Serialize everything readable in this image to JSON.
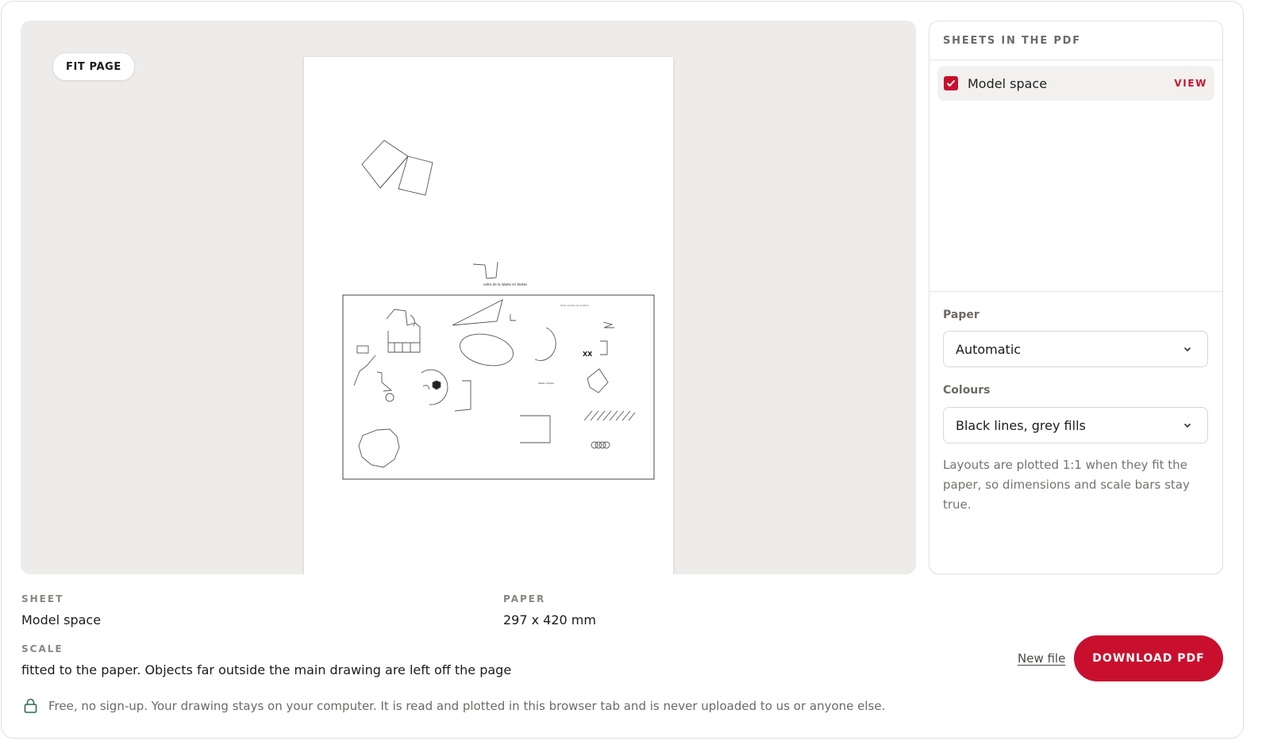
{
  "preview": {
    "fit_label": "FIT PAGE",
    "drawing_texts": {
      "caption_above": "vetro de la labelo en blokes",
      "small_note": "Texto primer en el título",
      "center_note": "labelo simple",
      "xx_mark": "XX"
    }
  },
  "sidebar": {
    "heading": "SHEETS IN THE PDF",
    "sheets": [
      {
        "name": "Model space",
        "checked": true,
        "action": "VIEW"
      }
    ],
    "paper": {
      "label": "Paper",
      "value": "Automatic"
    },
    "colours": {
      "label": "Colours",
      "value": "Black lines, grey fills"
    },
    "hint": "Layouts are plotted 1:1 when they fit the paper, so dimensions and scale bars stay true."
  },
  "info": {
    "sheet_label": "SHEET",
    "sheet_value": "Model space",
    "paper_label": "PAPER",
    "paper_value": "297 x 420 mm",
    "scale_label": "SCALE",
    "scale_value": "fitted to the paper. Objects far outside the main drawing are left off the page"
  },
  "actions": {
    "new_file": "New file",
    "download": "DOWNLOAD PDF"
  },
  "privacy": "Free, no sign-up. Your drawing stays on your computer. It is read and plotted in this browser tab and is never uploaded to us or anyone else.",
  "colors": {
    "accent": "#c8102e",
    "preview_bg": "#edecea"
  },
  "icons": {
    "checkbox": "check-icon",
    "select": "chevron-down-icon",
    "privacy": "lock-icon"
  }
}
